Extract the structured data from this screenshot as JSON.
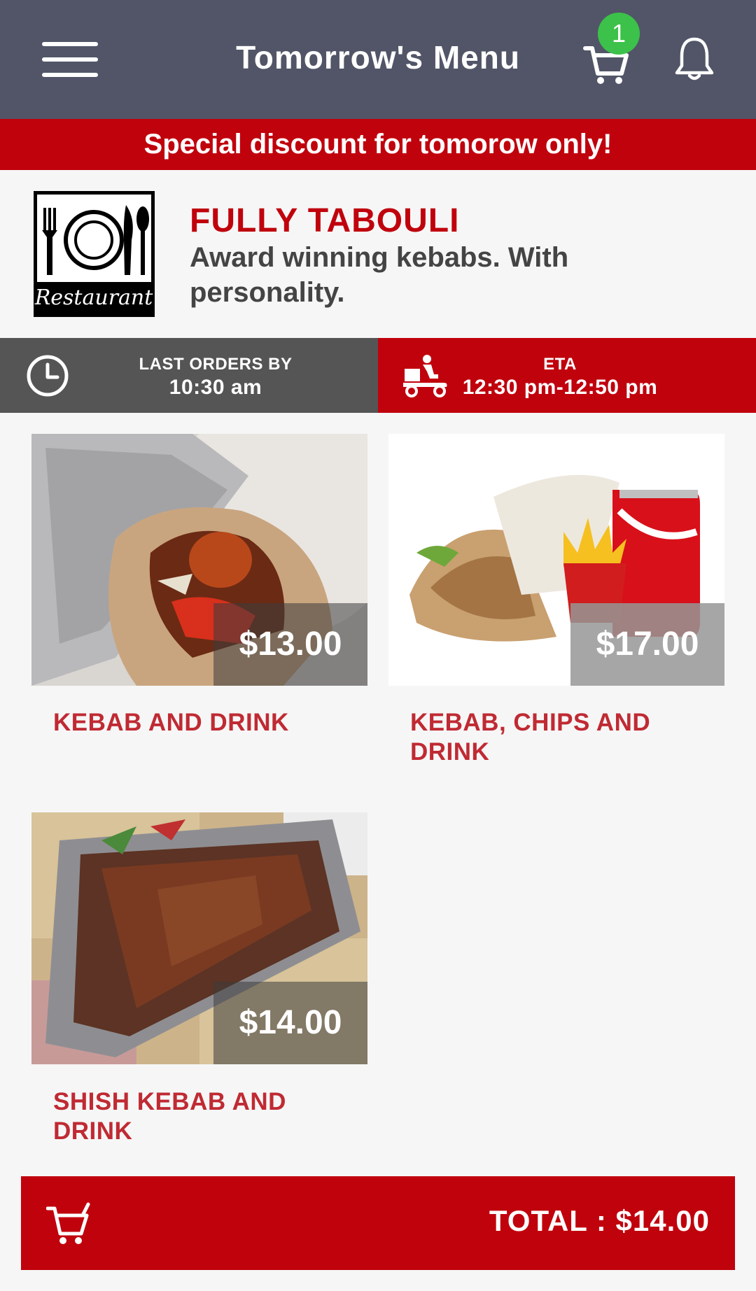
{
  "header": {
    "title": "Tomorrow's Menu",
    "cart_count": "1",
    "icons": [
      "menu-icon",
      "cart-icon",
      "bell-icon"
    ]
  },
  "promo": {
    "text": "Special discount for tomorow only!"
  },
  "restaurant": {
    "logo_text": "Restaurant",
    "name": "FULLY TABOULI",
    "description": "Award winning kebabs. With personality."
  },
  "info": {
    "last_orders_label": "LAST ORDERS BY",
    "last_orders_value": "10:30 am",
    "eta_label": "ETA",
    "eta_value": "12:30 pm-12:50 pm"
  },
  "menu": {
    "items": [
      {
        "name": "KEBAB AND DRINK",
        "price": "$13.00"
      },
      {
        "name": "KEBAB, CHIPS AND DRINK",
        "price": "$17.00"
      },
      {
        "name": "SHISH KEBAB AND DRINK",
        "price": "$14.00"
      }
    ]
  },
  "footer": {
    "total": "TOTAL : $14.00"
  },
  "colors": {
    "header": "#515567",
    "accent": "#c0020d",
    "badge": "#3cc14a",
    "info_dark": "#555555",
    "item_text": "#c02a33"
  }
}
